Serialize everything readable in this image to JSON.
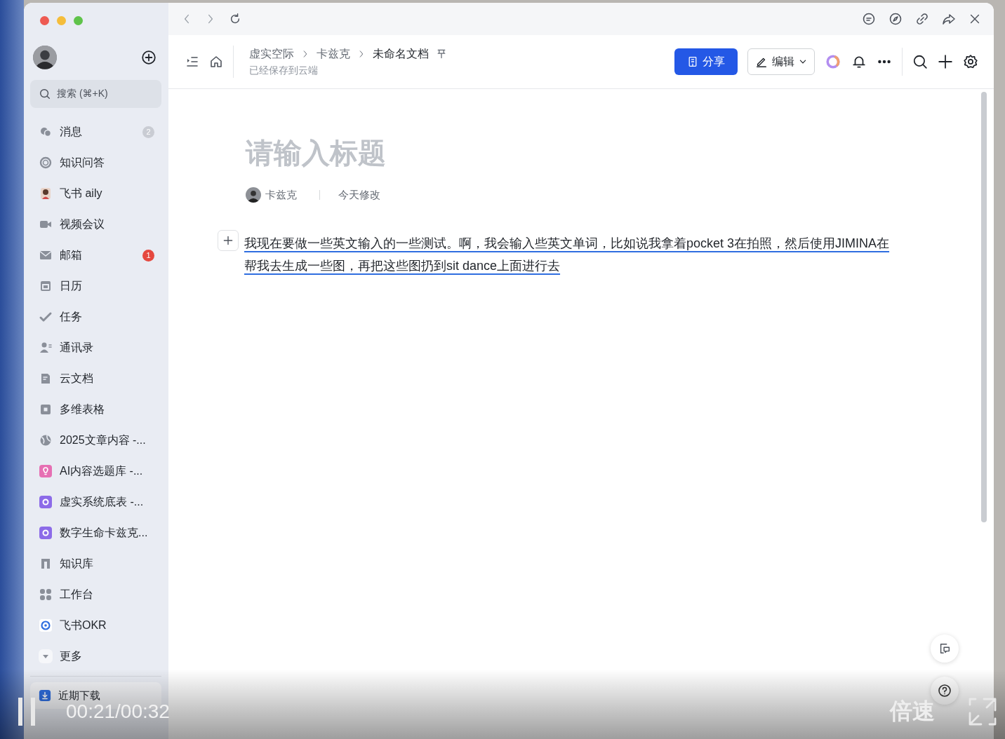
{
  "sidebar": {
    "search": {
      "placeholder": "搜索 (⌘+K)"
    },
    "items": [
      {
        "label": "消息",
        "badge": "2",
        "color": "#c9ccd3"
      },
      {
        "label": "知识问答"
      },
      {
        "label": "飞书 aily"
      },
      {
        "label": "视频会议"
      },
      {
        "label": "邮箱",
        "badge": "1",
        "color": "#e5483f"
      },
      {
        "label": "日历"
      },
      {
        "label": "任务"
      },
      {
        "label": "通讯录"
      },
      {
        "label": "云文档"
      },
      {
        "label": "多维表格"
      },
      {
        "label": "2025文章内容 -..."
      },
      {
        "label": "AI内容选题库 -..."
      },
      {
        "label": "虚实系统底表 -..."
      },
      {
        "label": "数字生命卡兹克..."
      },
      {
        "label": "知识库"
      },
      {
        "label": "工作台"
      },
      {
        "label": "飞书OKR"
      },
      {
        "label": "更多"
      }
    ],
    "footer_item": {
      "label": "近期下载"
    }
  },
  "toolbar": {
    "breadcrumbs": [
      {
        "label": "虚实空际",
        "current": false
      },
      {
        "label": "卡兹克",
        "current": false
      },
      {
        "label": "未命名文档",
        "current": true
      }
    ],
    "save_status": "已经保存到云端",
    "share_button": "分享",
    "edit_button": "编辑"
  },
  "document": {
    "title_placeholder": "请输入标题",
    "author": "卡兹克",
    "modified": "今天修改",
    "paragraph": "我现在要做一些英文输入的一些测试。啊，我会输入些英文单词，比如说我拿着pocket 3在拍照，然后使用JIMINA在帮我去生成一些图，再把这些图扔到sit dance上面进行去"
  },
  "video_player": {
    "playing": true,
    "time": "00:21/00:32",
    "speed_button": "倍速"
  }
}
